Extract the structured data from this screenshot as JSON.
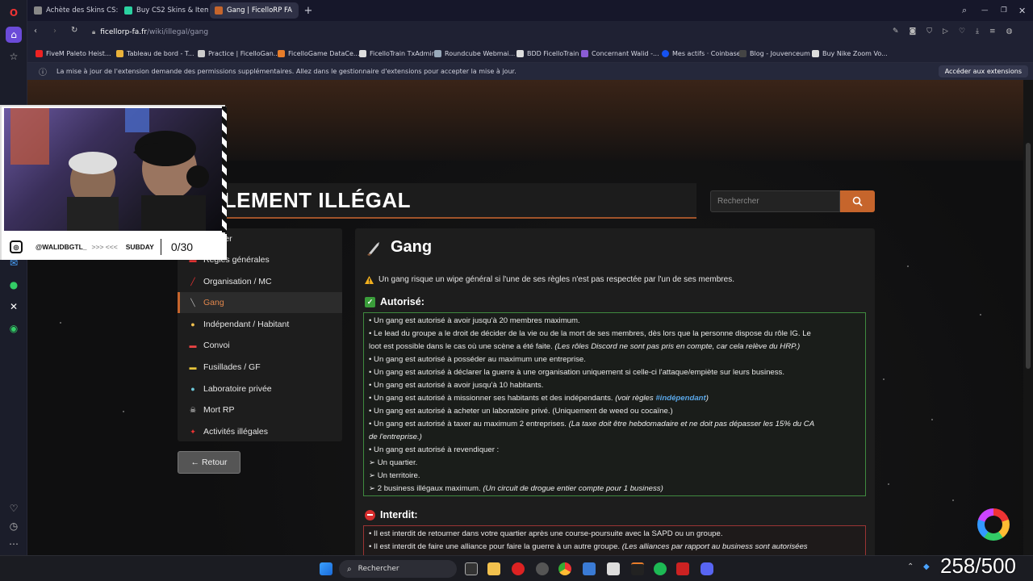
{
  "tabs": [
    {
      "label": "Achète des Skins CS:GO/C",
      "active": false
    },
    {
      "label": "Buy CS2 Skins & Items Sk",
      "active": false
    },
    {
      "label": "Gang | FicelloRP FA",
      "active": true
    }
  ],
  "address": {
    "host": "ficellorp-fa.fr",
    "path": "/wiki/illegal/gang"
  },
  "bookmarks": [
    "FiveM Paleto Heist...",
    "Tableau de bord - T...",
    "Practice | FicelloGan...",
    "FicelloGame DataCe...",
    "FicelloTrain TxAdmin",
    "Roundcube Webmai...",
    "BDD FicelloTrain",
    "Concernant Walid -...",
    "Mes actifs · Coinbase",
    "Blog - Jouvenceum",
    "Buy Nike Zoom Vo..."
  ],
  "notice": {
    "text": "La mise à jour de l'extension demande des permissions supplémentaires. Allez dans le gestionnaire d'extensions pour accepter la mise à jour.",
    "button": "Accéder aux extensions"
  },
  "page": {
    "title": "GLEMENT ILLÉGAL",
    "search_placeholder": "Rechercher",
    "nav": [
      {
        "label": "Dossier",
        "icon": "folder-icon",
        "glyph": "▪",
        "active": false
      },
      {
        "label": "Règles générales",
        "icon": "book-icon",
        "glyph": "▬",
        "active": false
      },
      {
        "label": "Organisation / MC",
        "icon": "dynamite-icon",
        "glyph": "╱",
        "active": false
      },
      {
        "label": "Gang",
        "icon": "knife-icon",
        "glyph": "╲",
        "active": true
      },
      {
        "label": "Indépendant / Habitant",
        "icon": "person-icon",
        "glyph": "●",
        "active": false
      },
      {
        "label": "Convoi",
        "icon": "car-icon",
        "glyph": "▬",
        "active": false
      },
      {
        "label": "Fusillades / GF",
        "icon": "gun-icon",
        "glyph": "▬",
        "active": false
      },
      {
        "label": "Laboratoire privée",
        "icon": "flask-icon",
        "glyph": "●",
        "active": false
      },
      {
        "label": "Mort RP",
        "icon": "skull-icon",
        "glyph": "☠",
        "active": false
      },
      {
        "label": "Activités illégales",
        "icon": "pin-icon",
        "glyph": "✦",
        "active": false
      }
    ],
    "back_label": "← Retour",
    "heading": "Gang",
    "warning": "Un gang risque un wipe général si l'une de ses règles n'est pas respectée par l'un de ses membres.",
    "allowed_title": "Autorisé:",
    "forbidden_title": "Interdit:",
    "allowed": [
      {
        "text": "• Un gang est autorisé à avoir jusqu'à 20 membres maximum.",
        "italic": "",
        "hl": "",
        "tail": ""
      },
      {
        "text": "• Le lead du groupe a le droit de décider de la vie ou de la mort de ses membres, dès lors que la personne dispose du rôle IG. Le",
        "italic": "",
        "hl": "",
        "tail": ""
      },
      {
        "text": "loot est possible dans le cas où une scène a été faite. ",
        "italic": "(Les rôles Discord ne sont pas pris en compte, car cela relève du HRP.)",
        "hl": "",
        "tail": ""
      },
      {
        "text": "• Un gang est autorisé à posséder au maximum une entreprise.",
        "italic": "",
        "hl": "",
        "tail": ""
      },
      {
        "text": "• Un gang est autorisé à déclarer la guerre à une organisation uniquement si celle-ci l'attaque/empiète sur leurs business.",
        "italic": "",
        "hl": "",
        "tail": ""
      },
      {
        "text": "• Un gang est autorisé à avoir jusqu'à 10 habitants.",
        "italic": "",
        "hl": "",
        "tail": ""
      },
      {
        "text": "• Un gang est autorisé à missionner ses habitants et des indépendants. ",
        "italic": "(voir règles ",
        "hl": "#indépendant",
        "tail": ")"
      },
      {
        "text": "• Un gang est autorisé à acheter un laboratoire privé. (Uniquement de weed ou cocaïne.)",
        "italic": "",
        "hl": "",
        "tail": ""
      },
      {
        "text": "• Un gang est autorisé à taxer au maximum 2 entreprises. ",
        "italic": "(La taxe doit être hebdomadaire et ne doit pas dépasser les 15% du CA",
        "hl": "",
        "tail": ""
      },
      {
        "text": "",
        "italic": "de l'entreprise.)",
        "hl": "",
        "tail": ""
      },
      {
        "text": "• Un gang est autorisé à revendiquer :",
        "italic": "",
        "hl": "",
        "tail": ""
      },
      {
        "text": "  ➢ Un quartier.",
        "italic": "",
        "hl": "",
        "tail": ""
      },
      {
        "text": "  ➢ Un territoire.",
        "italic": "",
        "hl": "",
        "tail": ""
      },
      {
        "text": "  ➢ 2 business illégaux maximum. ",
        "italic": "(Un circuit de drogue entier compte pour 1 business)",
        "hl": "",
        "tail": ""
      }
    ],
    "forbidden": [
      {
        "text": "• Il est interdit de retourner dans votre quartier après une course-poursuite avec la SAPD ou un groupe.",
        "italic": ""
      },
      {
        "text": "• Il est interdit de faire une alliance pour faire la guerre à un autre groupe. ",
        "italic": "(Les alliances par rapport au business sont autorisées"
      }
    ]
  },
  "webcam": {
    "handle": "@WALIDBGTL_",
    "arrows": ">>> <<<",
    "label": "SUBDAY",
    "count": "0/30"
  },
  "taskbar": {
    "search": "Rechercher"
  },
  "counter": "258/500",
  "colors": {
    "accent": "#c6652c",
    "allowed_border": "#3f8a3f",
    "forbidden_border": "#9b3434",
    "link": "#5aa7e8"
  }
}
